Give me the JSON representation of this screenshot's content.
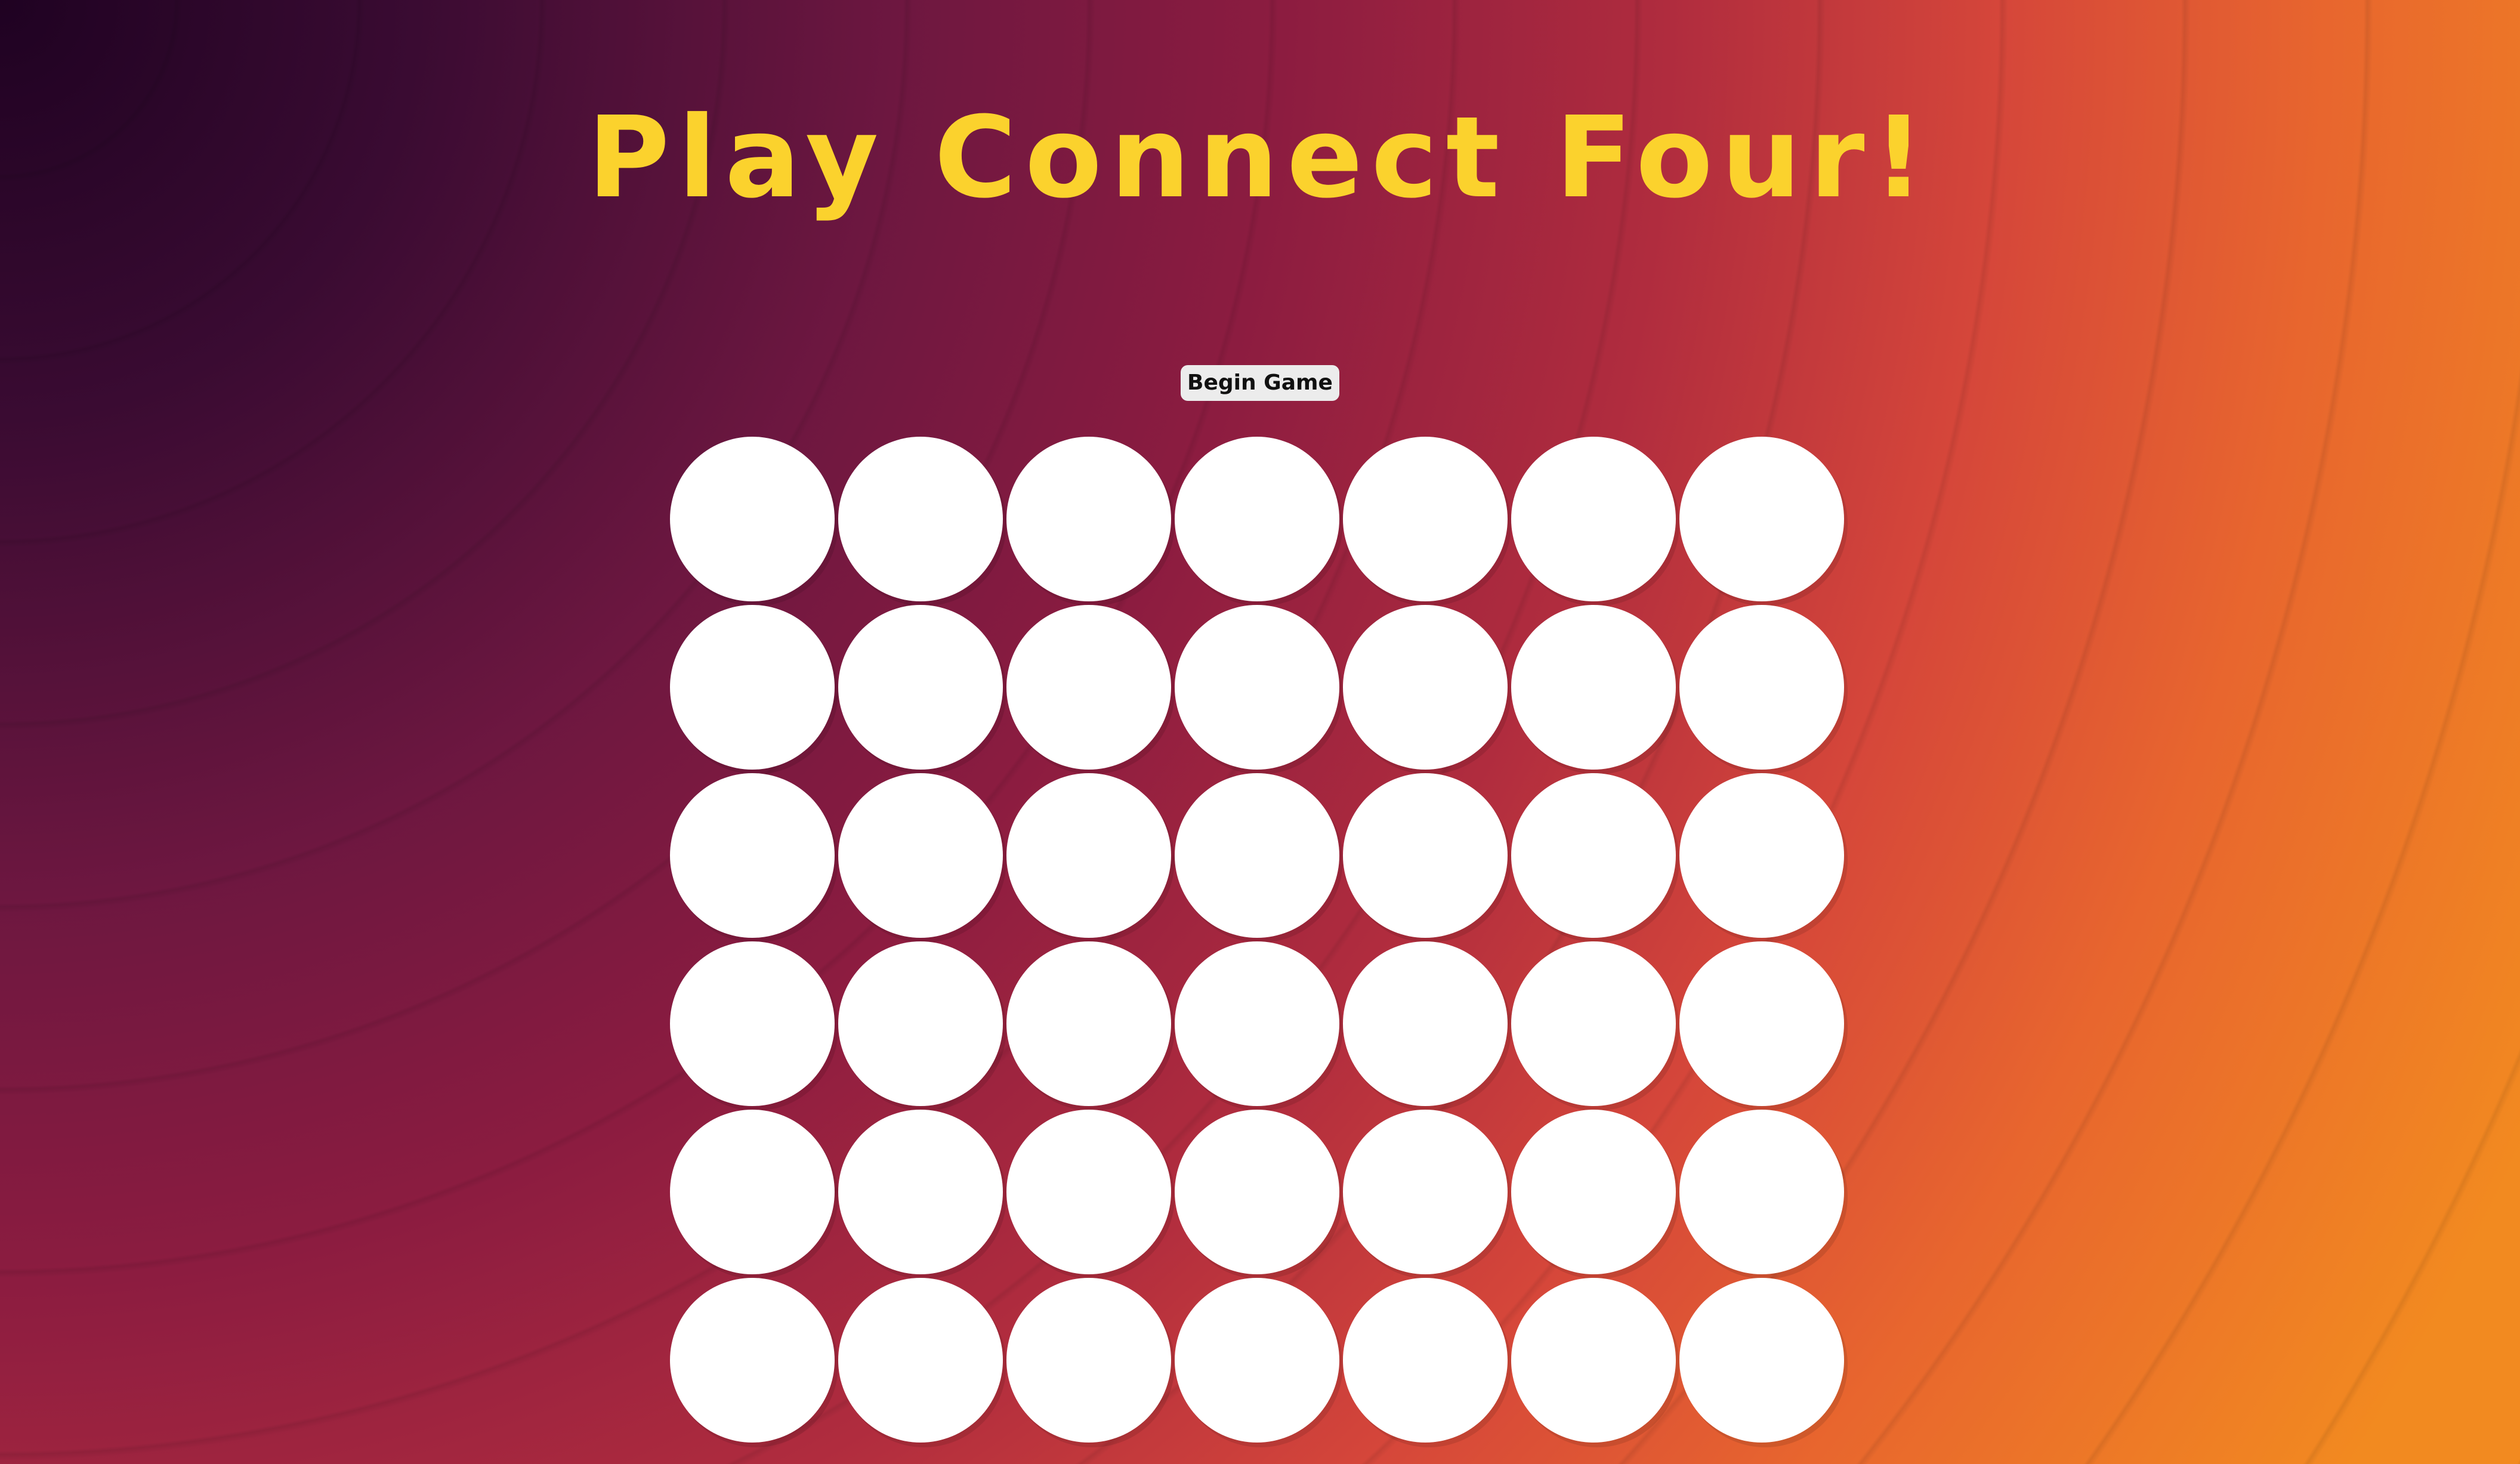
{
  "title": "Play Connect Four!",
  "controls": {
    "begin_label": "Begin Game"
  },
  "board": {
    "columns": 7,
    "rows": 6,
    "cells": [
      [
        "empty",
        "empty",
        "empty",
        "empty",
        "empty",
        "empty",
        "empty"
      ],
      [
        "empty",
        "empty",
        "empty",
        "empty",
        "empty",
        "empty",
        "empty"
      ],
      [
        "empty",
        "empty",
        "empty",
        "empty",
        "empty",
        "empty",
        "empty"
      ],
      [
        "empty",
        "empty",
        "empty",
        "empty",
        "empty",
        "empty",
        "empty"
      ],
      [
        "empty",
        "empty",
        "empty",
        "empty",
        "empty",
        "empty",
        "empty"
      ],
      [
        "empty",
        "empty",
        "empty",
        "empty",
        "empty",
        "empty",
        "empty"
      ]
    ]
  },
  "colors": {
    "title": "#fbd22d",
    "cell_empty": "#ffffff",
    "button_bg": "#ececec",
    "background_dark": "#1f0222",
    "background_light": "#f28a20"
  }
}
